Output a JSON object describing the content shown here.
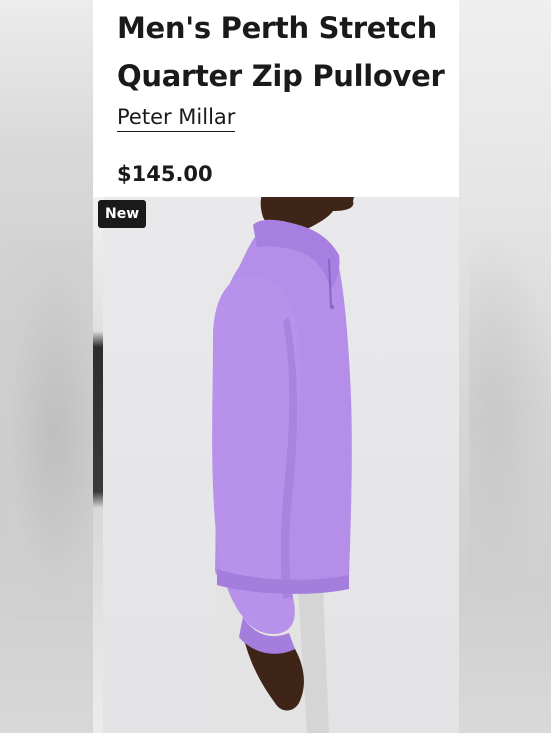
{
  "product": {
    "title_line1": "Men's Perth Stretch",
    "title_line2": "Quarter Zip Pullover",
    "brand": "Peter Millar",
    "price": "$145.00",
    "badge": "New"
  },
  "colors": {
    "garment": "#b48ee8",
    "background": "#e7e7e9",
    "text": "#1a1a1a"
  },
  "icons": {
    "photo": "product-photo-illustration"
  }
}
